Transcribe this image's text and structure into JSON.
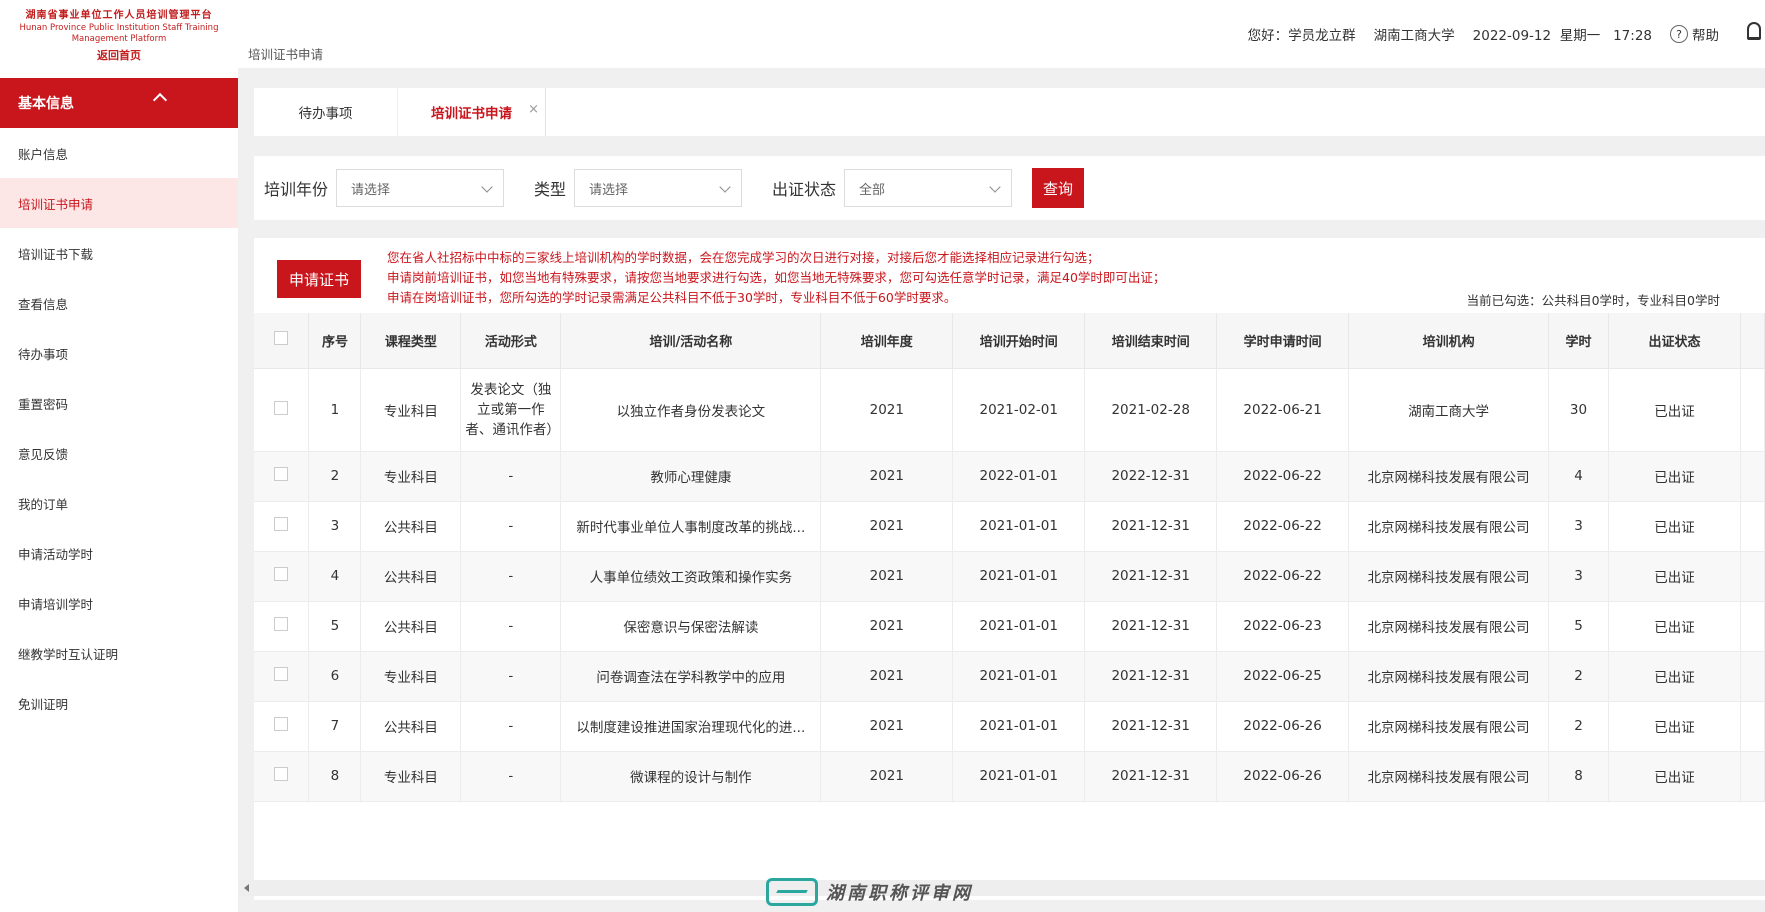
{
  "sidebar": {
    "logo": {
      "line1": "湖南省事业单位工作人员培训管理平台",
      "line2a": "Hunan Province Public Institution Staff Training",
      "line2b": "Management Platform",
      "line3": "返回首页"
    },
    "section_title": "基本信息",
    "items": [
      {
        "label": "账户信息"
      },
      {
        "label": "培训证书申请"
      },
      {
        "label": "培训证书下载"
      },
      {
        "label": "查看信息"
      },
      {
        "label": "待办事项"
      },
      {
        "label": "重置密码"
      },
      {
        "label": "意见反馈"
      },
      {
        "label": "我的订单"
      },
      {
        "label": "申请活动学时"
      },
      {
        "label": "申请培训学时"
      },
      {
        "label": "继教学时互认证明"
      },
      {
        "label": "免训证明"
      }
    ],
    "active_index": 1
  },
  "header": {
    "breadcrumb": "培训证书申请",
    "greeting": "您好：学员龙立群",
    "org": "湖南工商大学",
    "date": "2022-09-12",
    "weekday": "星期一",
    "time": "17:28",
    "help": "帮助"
  },
  "tabs": [
    {
      "label": "待办事项"
    },
    {
      "label": "培训证书申请",
      "close": "×"
    }
  ],
  "filter": {
    "year_label": "培训年份",
    "year_placeholder": "请选择",
    "type_label": "类型",
    "type_placeholder": "请选择",
    "status_label": "出证状态",
    "status_value": "全部",
    "query_button": "查询"
  },
  "panel": {
    "apply_button": "申请证书",
    "notes": [
      "您在省人社招标中中标的三家线上培训机构的学时数据，会在您完成学习的次日进行对接，对接后您才能选择相应记录进行勾选；",
      "申请岗前培训证书，如您当地有特殊要求，请按您当地要求进行勾选，如您当地无特殊要求，您可勾选任意学时记录，满足40学时即可出证；",
      "申请在岗培训证书，您所勾选的学时记录需满足公共科目不低于30学时，专业科目不低于60学时要求。"
    ],
    "selected_info": "当前已勾选：公共科目0学时，专业科目0学时"
  },
  "table": {
    "headers": [
      "序号",
      "课程类型",
      "活动形式",
      "培训/活动名称",
      "培训年度",
      "培训开始时间",
      "培训结束时间",
      "学时申请时间",
      "培训机构",
      "学时",
      "出证状态"
    ],
    "rows": [
      [
        "1",
        "专业科目",
        "发表论文（独立或第一作者、通讯作者）",
        "以独立作者身份发表论文",
        "2021",
        "2021-02-01",
        "2021-02-28",
        "2022-06-21",
        "湖南工商大学",
        "30",
        "已出证"
      ],
      [
        "2",
        "专业科目",
        "-",
        "教师心理健康",
        "2021",
        "2022-01-01",
        "2022-12-31",
        "2022-06-22",
        "北京网梯科技发展有限公司",
        "4",
        "已出证"
      ],
      [
        "3",
        "公共科目",
        "-",
        "新时代事业单位人事制度改革的挑战...",
        "2021",
        "2021-01-01",
        "2021-12-31",
        "2022-06-22",
        "北京网梯科技发展有限公司",
        "3",
        "已出证"
      ],
      [
        "4",
        "公共科目",
        "-",
        "人事单位绩效工资政策和操作实务",
        "2021",
        "2021-01-01",
        "2021-12-31",
        "2022-06-22",
        "北京网梯科技发展有限公司",
        "3",
        "已出证"
      ],
      [
        "5",
        "公共科目",
        "-",
        "保密意识与保密法解读",
        "2021",
        "2021-01-01",
        "2021-12-31",
        "2022-06-23",
        "北京网梯科技发展有限公司",
        "5",
        "已出证"
      ],
      [
        "6",
        "专业科目",
        "-",
        "问卷调查法在学科教学中的应用",
        "2021",
        "2021-01-01",
        "2021-12-31",
        "2022-06-25",
        "北京网梯科技发展有限公司",
        "2",
        "已出证"
      ],
      [
        "7",
        "公共科目",
        "-",
        "以制度建设推进国家治理现代化的进...",
        "2021",
        "2021-01-01",
        "2021-12-31",
        "2022-06-26",
        "北京网梯科技发展有限公司",
        "2",
        "已出证"
      ],
      [
        "8",
        "专业科目",
        "-",
        "微课程的设计与制作",
        "2021",
        "2021-01-01",
        "2021-12-31",
        "2022-06-26",
        "北京网梯科技发展有限公司",
        "8",
        "已出证"
      ]
    ]
  },
  "watermark": "湖南职称评审网",
  "colors": {
    "brand_red": "#c9161d",
    "active_bg": "#fce6e6",
    "watermark_teal": "#2aa8a0"
  }
}
